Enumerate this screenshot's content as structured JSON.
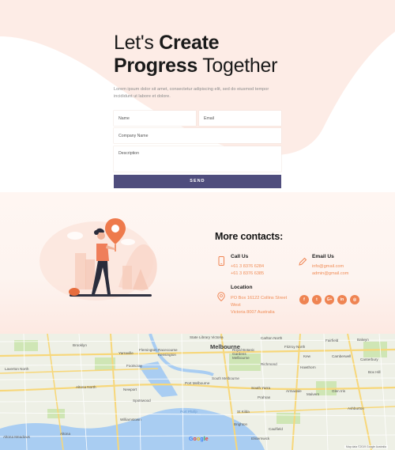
{
  "hero": {
    "title_lead": "Let's",
    "title_bold1": "Create",
    "title_bold2": "Progress",
    "title_tail": "Together",
    "lead_text": "Lorem ipsum dolor sit amet, consectetur adipiscing elit, sed do eiusmod tempor incididunt ut labore et dolore."
  },
  "form": {
    "name_placeholder": "Name",
    "email_placeholder": "Email",
    "company_placeholder": "Company Name",
    "description_placeholder": "Description",
    "send_label": "SEND"
  },
  "contacts": {
    "title": "More contacts:",
    "call": {
      "heading": "Call Us",
      "lines": [
        "+61 3 8376 6284",
        "+61 3 8376 6385"
      ]
    },
    "email": {
      "heading": "Email Us",
      "lines": [
        "info@gmail.com",
        "admin@gmail.com"
      ]
    },
    "location": {
      "heading": "Location",
      "lines": [
        "PO Box 16122 Collins Street",
        "West",
        "Victoria 8007 Australia"
      ]
    },
    "socials": [
      {
        "icon": "facebook-icon",
        "glyph": "f"
      },
      {
        "icon": "twitter-icon",
        "glyph": "t"
      },
      {
        "icon": "google-plus-icon",
        "glyph": "G+"
      },
      {
        "icon": "linkedin-icon",
        "glyph": "in"
      },
      {
        "icon": "instagram-icon",
        "glyph": "◎"
      }
    ]
  },
  "map": {
    "city": "Melbourne",
    "labels": [
      "Brooklyn",
      "Yarraville",
      "Footscray",
      "Kensington",
      "Carlton North",
      "Fitzroy North",
      "Fairfield",
      "Balwyn",
      "Laverton North",
      "Altona North",
      "Newport",
      "Spotswood",
      "Williamstown",
      "Altona",
      "Port Melbourne",
      "South Melbourne",
      "Richmond",
      "Hawthorn",
      "South Yarra",
      "Prahran",
      "Malvern",
      "St Kilda",
      "Caulfield",
      "Armadale",
      "Glen Iris",
      "Camberwell",
      "Kew",
      "Canterbury",
      "Box Hill",
      "Ashburton",
      "Elsternwick",
      "Brighton",
      "Altona Meadows",
      "State Library Victoria",
      "Royal Botanic Gardens Melbourne",
      "Flemington Racecourse",
      "Port Phillip"
    ],
    "water_label": "Port Phillip",
    "google_label": "Google",
    "attribution": "Map data ©2019 Google   Australia"
  },
  "colors": {
    "accent": "#ef8452",
    "button": "#4f4d7d",
    "peach": "#fdeee8"
  }
}
